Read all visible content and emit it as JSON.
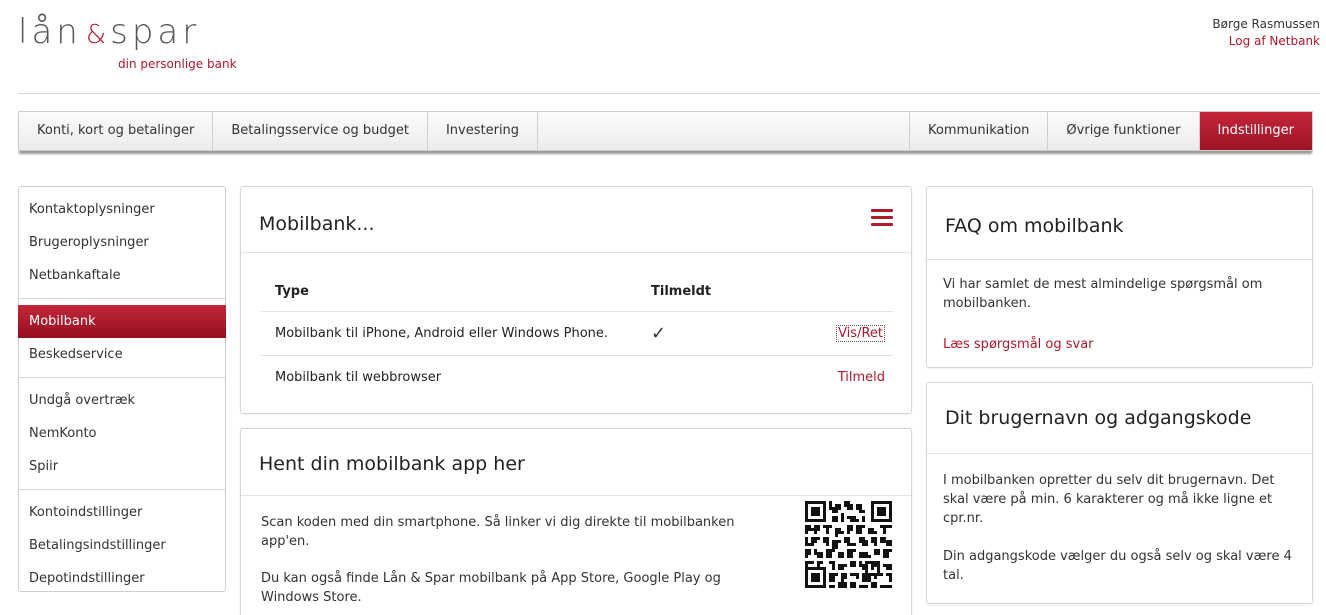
{
  "header": {
    "logo_left": "lån",
    "logo_amp": "&",
    "logo_right": "spar",
    "tagline": "din personlige bank",
    "user_name": "Børge Rasmussen",
    "logout_label": "Log af Netbank"
  },
  "topnav": {
    "left": [
      "Konti, kort og betalinger",
      "Betalingsservice og budget",
      "Investering"
    ],
    "right": [
      "Kommunikation",
      "Øvrige funktioner",
      "Indstillinger"
    ],
    "active": "Indstillinger"
  },
  "sidebar": {
    "groups": [
      [
        "Kontaktoplysninger",
        "Brugeroplysninger",
        "Netbankaftale"
      ],
      [
        "Mobilbank",
        "Beskedservice"
      ],
      [
        "Undgå overtræk",
        "NemKonto",
        "Spiir"
      ],
      [
        "Kontoindstillinger",
        "Betalingsindstillinger",
        "Depotindstillinger"
      ]
    ],
    "active": "Mobilbank"
  },
  "mobilbank": {
    "title": "Mobilbank...",
    "menu_icon": "hamburger-icon",
    "col_type": "Type",
    "col_tilmeldt": "Tilmeldt",
    "rows": [
      {
        "type": "Mobilbank til iPhone, Android eller Windows Phone.",
        "tilmeldt": "✓",
        "action": "Vis/Ret"
      },
      {
        "type": "Mobilbank til webbrowser",
        "tilmeldt": "",
        "action": "Tilmeld"
      }
    ]
  },
  "app": {
    "title": "Hent din mobilbank app her",
    "text1": "Scan koden med din smartphone. Så linker vi dig direkte til mobilbanken app'en.",
    "text2": "Du kan også finde Lån & Spar mobilbank på App Store, Google Play og Windows Store."
  },
  "faq": {
    "title": "FAQ om mobilbank",
    "text": "Vi har samlet de mest almindelige spørgsmål om mobilbanken.",
    "link": "Læs spørgsmål og svar"
  },
  "login_info": {
    "title": "Dit brugernavn og adgangskode",
    "text1": "I mobilbanken opretter du selv dit brugernavn. Det skal være på min. 6 karakterer og må ikke ligne et cpr.nr.",
    "text2": "Din adgangskode vælger du også selv og skal være 4 tal."
  },
  "colors": {
    "brand_red": "#b0182b",
    "text": "#222222",
    "border": "#d6d6d6"
  }
}
